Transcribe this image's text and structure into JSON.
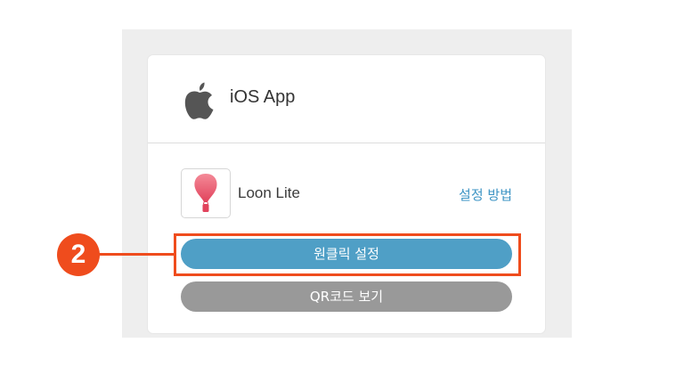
{
  "platform": {
    "icon": "apple-icon",
    "title": "iOS App"
  },
  "app": {
    "icon": "hot-air-balloon-icon",
    "name": "Loon Lite",
    "setup_link": "설정 방법"
  },
  "buttons": {
    "oneclick_label": "원클릭 설정",
    "qr_label": "QR코드 보기"
  },
  "annotation": {
    "step_number": "2",
    "color": "#ef4c1d"
  },
  "colors": {
    "primary_button": "#4f9fc6",
    "secondary_button": "#999999",
    "link": "#3d94c4"
  }
}
